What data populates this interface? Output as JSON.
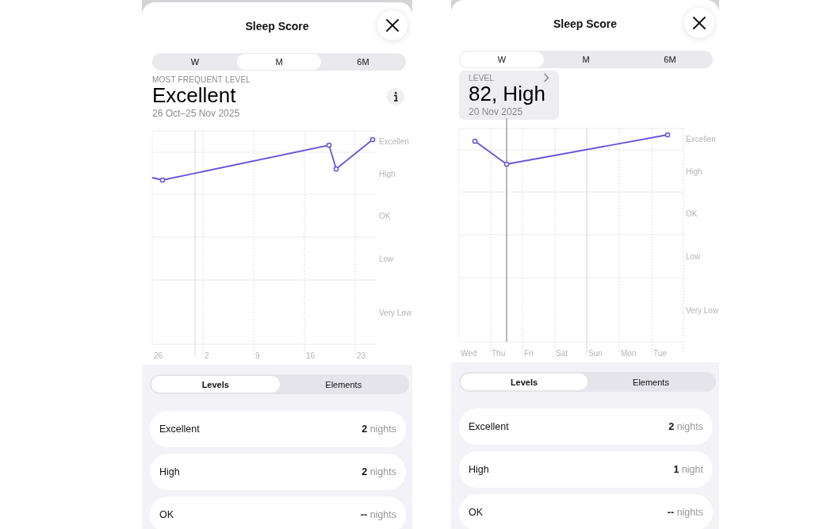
{
  "panels": [
    {
      "title": "Sleep Score",
      "periods": [
        {
          "label": "W",
          "selected": false
        },
        {
          "label": "M",
          "selected": true
        },
        {
          "label": "6M",
          "selected": false
        }
      ],
      "header": {
        "kind": "summary",
        "label": "MOST FREQUENT LEVEL",
        "value": "Excellent",
        "date": "26 Oct–25 Nov 2025"
      },
      "chart": {
        "y_labels": [
          "Excellen",
          "High",
          "OK",
          "Low",
          "Very Low"
        ],
        "x_labels": [
          "26",
          "2",
          "9",
          "16",
          "23"
        ]
      },
      "views": [
        {
          "label": "Levels",
          "selected": true
        },
        {
          "label": "Elements",
          "selected": false
        }
      ],
      "levels": [
        {
          "name": "Excellent",
          "count": "2",
          "unit": "nights"
        },
        {
          "name": "High",
          "count": "2",
          "unit": "nights"
        },
        {
          "name": "OK",
          "count": "--",
          "unit": "nights"
        }
      ]
    },
    {
      "title": "Sleep Score",
      "periods": [
        {
          "label": "W",
          "selected": true
        },
        {
          "label": "M",
          "selected": false
        },
        {
          "label": "6M",
          "selected": false
        }
      ],
      "header": {
        "kind": "tooltip",
        "label": "LEVEL",
        "value": "82, High",
        "date": "20 Nov 2025"
      },
      "chart": {
        "y_labels": [
          "Excellen",
          "High",
          "OK",
          "Low",
          "Very Low"
        ],
        "x_labels": [
          "Wed",
          "Thu",
          "Fri",
          "Sat",
          "Sun",
          "Mon",
          "Tue"
        ]
      },
      "views": [
        {
          "label": "Levels",
          "selected": true
        },
        {
          "label": "Elements",
          "selected": false
        }
      ],
      "levels": [
        {
          "name": "Excellent",
          "count": "2",
          "unit": "nights"
        },
        {
          "name": "High",
          "count": "1",
          "unit": "night"
        },
        {
          "name": "OK",
          "count": "--",
          "unit": "nights"
        }
      ]
    }
  ]
}
